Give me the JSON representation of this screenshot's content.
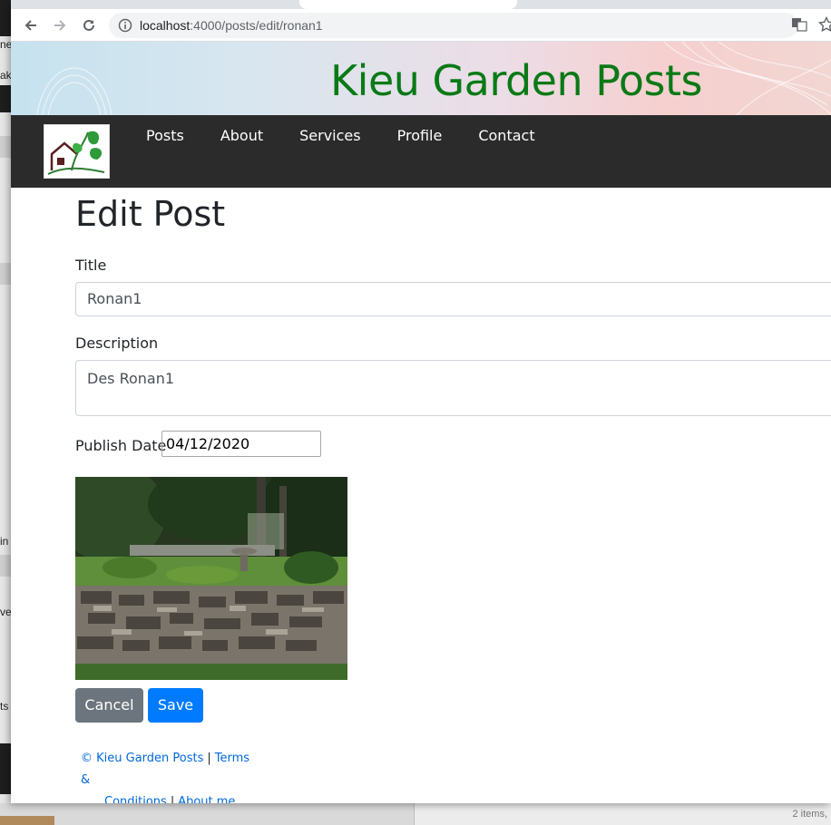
{
  "browser": {
    "url_host": "localhost",
    "url_path": ":4000/posts/edit/ronan1"
  },
  "site": {
    "title": "Kieu Garden Posts",
    "nav": [
      "Posts",
      "About",
      "Services",
      "Profile",
      "Contact"
    ]
  },
  "form": {
    "heading": "Edit Post",
    "title_label": "Title",
    "title_value": "Ronan1",
    "description_label": "Description",
    "description_value": "Des Ronan1",
    "date_label": "Publish Date",
    "date_value": "04/12/2020",
    "cancel_label": "Cancel",
    "save_label": "Save"
  },
  "footer": {
    "copyright": "© Kieu Garden Posts",
    "terms_part1": "Terms &",
    "terms_part2": "Conditions",
    "about": "About me"
  },
  "background": {
    "status_items": "2 items,"
  },
  "colors": {
    "site_title": "#0a7a17",
    "navbar": "#2b2b2b",
    "save_button": "#007bff",
    "cancel_button": "#6c757d",
    "link": "#0069d9"
  }
}
